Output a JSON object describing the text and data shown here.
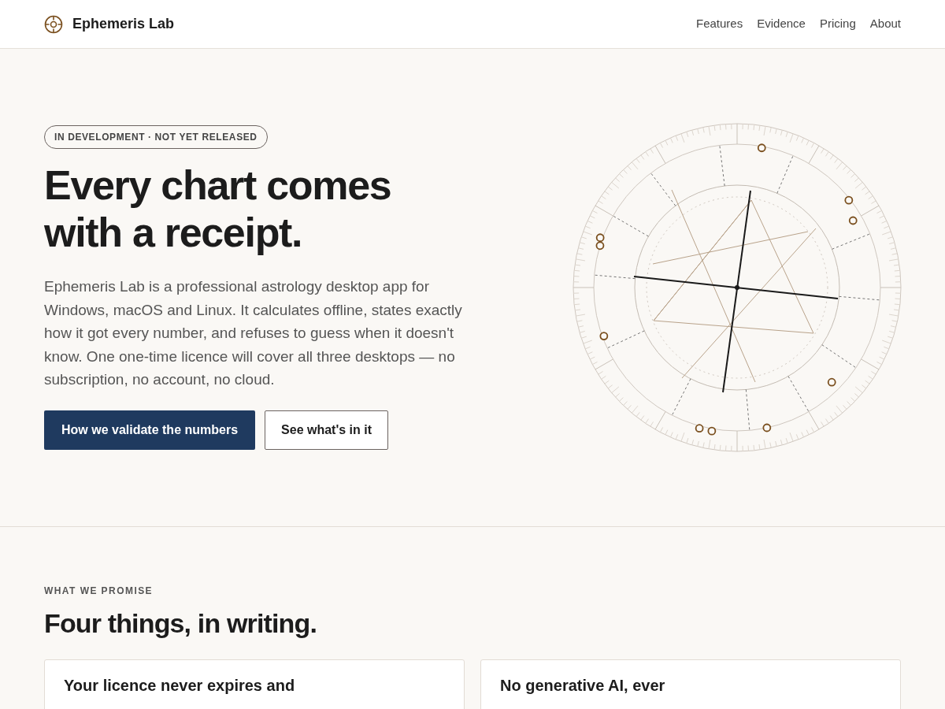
{
  "header": {
    "brand": "Ephemeris Lab",
    "nav": [
      "Features",
      "Evidence",
      "Pricing",
      "About"
    ]
  },
  "hero": {
    "badge": "IN DEVELOPMENT · NOT YET RELEASED",
    "title": "Every chart comes with a receipt.",
    "body": "Ephemeris Lab is a professional astrology desktop app for Windows, macOS and Linux. It calculates offline, states exactly how it got every number, and refuses to guess when it doesn't know. One one-time licence will cover all three desktops — no subscription, no account, no cloud.",
    "buttons": [
      {
        "label": "How we validate the numbers",
        "kind": "primary"
      },
      {
        "label": "See what's in it",
        "kind": "secondary"
      }
    ]
  },
  "promise": {
    "eyebrow": "WHAT WE PROMISE",
    "title": "Four things, in writing.",
    "cards": [
      {
        "title": "Your licence never expires and"
      },
      {
        "title": "No generative AI, ever"
      }
    ]
  }
}
